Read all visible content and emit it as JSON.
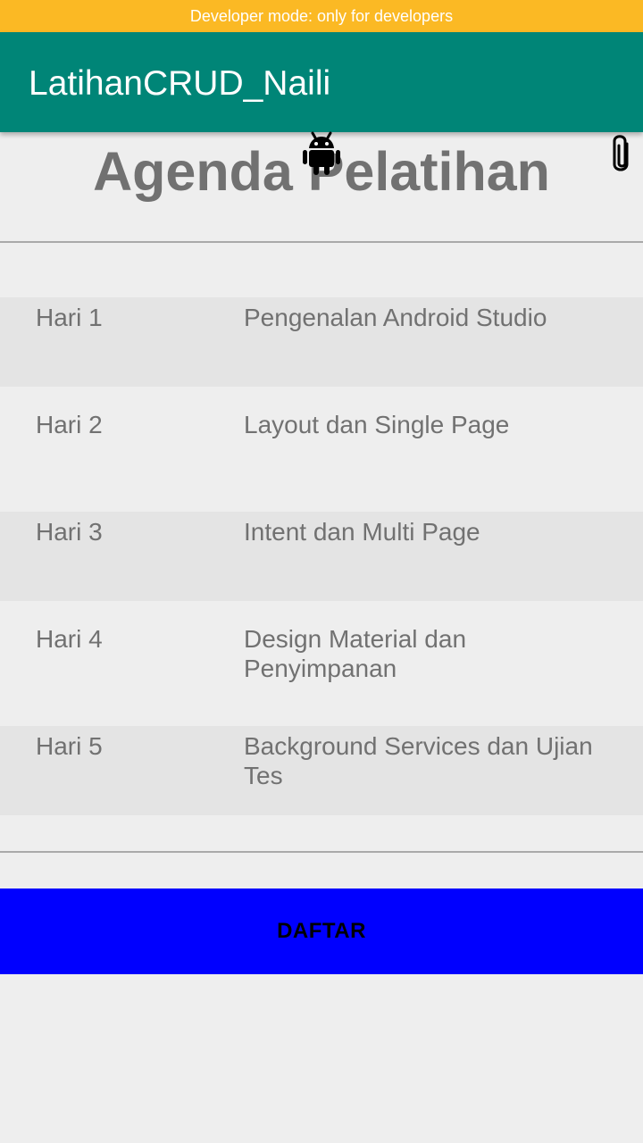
{
  "status_banner": {
    "text": "Developer mode: only for developers",
    "color": "#fbb924"
  },
  "app_bar": {
    "title": "LatihanCRUD_Naili",
    "color": "#008577"
  },
  "page": {
    "heading": "Agenda Pelatihan"
  },
  "overlay_icons": {
    "android": "android-icon",
    "attachment": "paperclip-icon"
  },
  "agenda": [
    {
      "day": "Hari 1",
      "topic": "Pengenalan Android Studio"
    },
    {
      "day": "Hari 2",
      "topic": "Layout dan Single Page"
    },
    {
      "day": "Hari 3",
      "topic": "Intent dan Multi Page"
    },
    {
      "day": "Hari 4",
      "topic": "Design Material dan Penyimpanan"
    },
    {
      "day": "Hari 5",
      "topic": "Background Services dan Ujian Tes"
    }
  ],
  "register_button": {
    "label": "DAFTAR",
    "color": "#0000ff"
  }
}
